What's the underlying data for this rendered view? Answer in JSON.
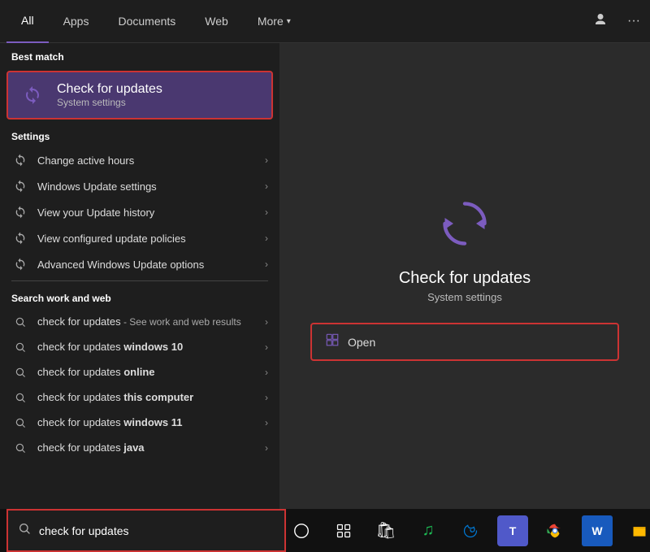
{
  "nav": {
    "tabs": [
      {
        "label": "All",
        "active": true
      },
      {
        "label": "Apps",
        "active": false
      },
      {
        "label": "Documents",
        "active": false
      },
      {
        "label": "Web",
        "active": false
      },
      {
        "label": "More",
        "active": false,
        "has_chevron": true
      }
    ]
  },
  "best_match": {
    "section_label": "Best match",
    "title": "Check for updates",
    "subtitle": "System settings"
  },
  "settings": {
    "section_label": "Settings",
    "items": [
      {
        "label": "Change active hours"
      },
      {
        "label": "Windows Update settings"
      },
      {
        "label": "View your Update history"
      },
      {
        "label": "View configured update policies"
      },
      {
        "label": "Advanced Windows Update options"
      }
    ]
  },
  "search_web": {
    "section_label": "Search work and web",
    "items": [
      {
        "prefix": "check for updates",
        "suffix": " - See work and web results",
        "bold_suffix": false
      },
      {
        "prefix": "check for updates ",
        "suffix": "windows 10",
        "bold_suffix": true
      },
      {
        "prefix": "check for updates ",
        "suffix": "online",
        "bold_suffix": true
      },
      {
        "prefix": "check for updates ",
        "suffix": "this computer",
        "bold_suffix": true
      },
      {
        "prefix": "check for updates ",
        "suffix": "windows 11",
        "bold_suffix": true
      },
      {
        "prefix": "check for updates ",
        "suffix": "java",
        "bold_suffix": true
      }
    ]
  },
  "right_panel": {
    "title": "Check for updates",
    "subtitle": "System settings",
    "open_label": "Open"
  },
  "search_bar": {
    "value": "check for updates",
    "placeholder": "check for updates"
  },
  "taskbar": {
    "icons": [
      {
        "name": "search",
        "symbol": "○"
      },
      {
        "name": "task-view",
        "symbol": "⧉"
      },
      {
        "name": "store",
        "symbol": "🛍"
      },
      {
        "name": "spotify",
        "symbol": "♫"
      },
      {
        "name": "edge",
        "symbol": "🌐"
      },
      {
        "name": "teams",
        "symbol": "T"
      },
      {
        "name": "chrome",
        "symbol": "G"
      },
      {
        "name": "word",
        "symbol": "W"
      },
      {
        "name": "explorer",
        "symbol": "📁"
      }
    ]
  },
  "colors": {
    "accent": "#7c5cbf",
    "selected_bg": "#4a3870",
    "red_border": "#cc3333"
  }
}
